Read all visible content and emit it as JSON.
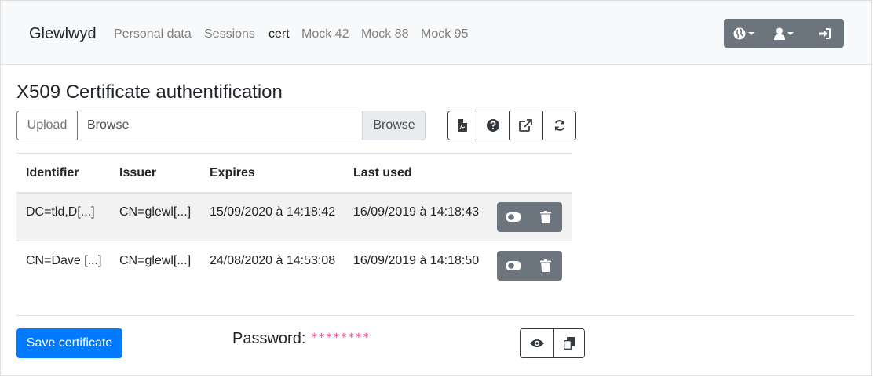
{
  "navbar": {
    "brand": "Glewlwyd",
    "items": [
      {
        "label": "Personal data",
        "active": false
      },
      {
        "label": "Sessions",
        "active": false
      },
      {
        "label": "cert",
        "active": true
      },
      {
        "label": "Mock 42",
        "active": false
      },
      {
        "label": "Mock 88",
        "active": false
      },
      {
        "label": "Mock 95",
        "active": false
      }
    ],
    "buttons": [
      "language-icon",
      "user-icon",
      "sign-in-icon"
    ]
  },
  "main": {
    "title": "X509 Certificate authentification",
    "upload": {
      "upload_label": "Upload",
      "file_value": "Browse",
      "browse_label": "Browse"
    },
    "tools": [
      "file-pdf-icon",
      "question-icon",
      "external-link-icon",
      "refresh-icon"
    ],
    "table": {
      "headers": [
        "Identifier",
        "Issuer",
        "Expires",
        "Last used"
      ],
      "rows": [
        {
          "identifier": "DC=tld,D[...]",
          "issuer": "CN=glewl[...]",
          "expires": "15/09/2020 à 14:18:42",
          "last_used": "16/09/2019 à 14:18:43"
        },
        {
          "identifier": "CN=Dave [...]",
          "issuer": "CN=glewl[...]",
          "expires": "24/08/2020 à 14:53:08",
          "last_used": "16/09/2019 à 14:18:50"
        }
      ]
    },
    "footer": {
      "save_label": "Save certificate",
      "password_label": "Password:",
      "password_value": "********"
    }
  },
  "colors": {
    "primary": "#007bff",
    "secondary": "#6c757d",
    "dark": "#343a40",
    "password": "#e83e8c"
  }
}
